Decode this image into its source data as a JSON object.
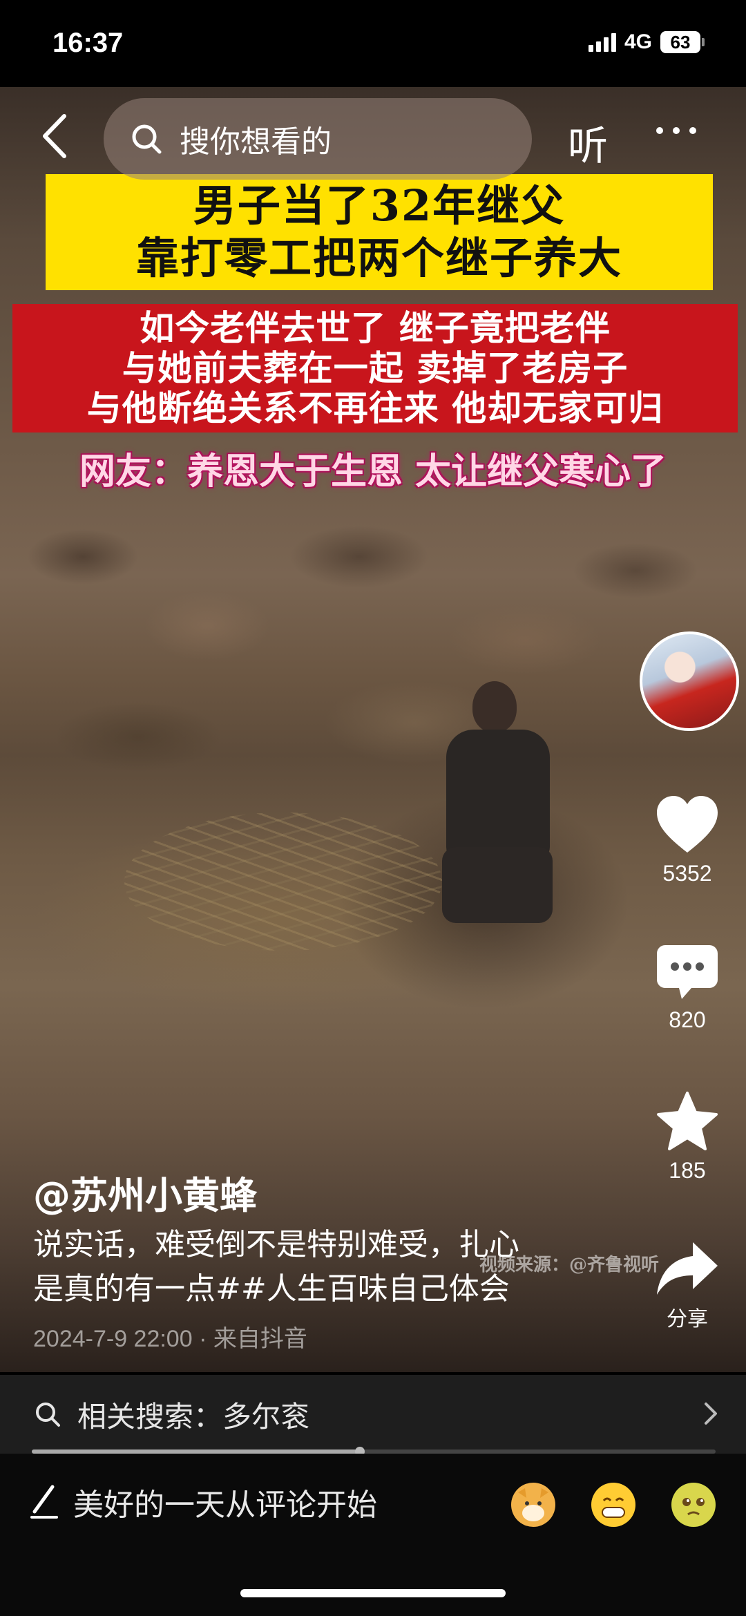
{
  "status_bar": {
    "time": "16:37",
    "network": "4G",
    "battery": "63"
  },
  "top_nav": {
    "search_placeholder": "搜你想看的",
    "listen_label": "听"
  },
  "captions": {
    "yellow_line1": "男子当了32年继父",
    "yellow_line2": "靠打零工把两个继子养大",
    "red_line1": "如今老伴去世了 继子竟把老伴",
    "red_line2": "与她前夫葬在一起 卖掉了老房子",
    "red_line3": "与他断绝关系不再往来 他却无家可归",
    "pink_line": "网友：养恩大于生恩 太让继父寒心了"
  },
  "watermark": "视频来源：@齐鲁视听",
  "sidebar": {
    "likes": "5352",
    "comments": "820",
    "favorites": "185",
    "share_label": "分享"
  },
  "post": {
    "author": "@苏州小黄蜂",
    "description_line1": "说实话，难受倒不是特别难受，扎心",
    "description_line2": "是真的有一点##人生百味自己体会",
    "meta": "2024-7-9 22:00 · 来自抖音"
  },
  "related": {
    "label": "相关搜索：",
    "term": "多尔衮"
  },
  "progress": {
    "fraction": 0.48
  },
  "comment_bar": {
    "placeholder": "美好的一天从评论开始"
  },
  "icons": {
    "back": "chevron-left-icon",
    "search": "search-icon",
    "more": "more-icon",
    "like": "heart-icon",
    "comment": "comment-icon",
    "favorite": "star-icon",
    "share": "share-icon",
    "pen": "pen-icon",
    "emojis": [
      "dog-emoji-icon",
      "grin-emoji-icon",
      "tearful-emoji-icon"
    ]
  }
}
